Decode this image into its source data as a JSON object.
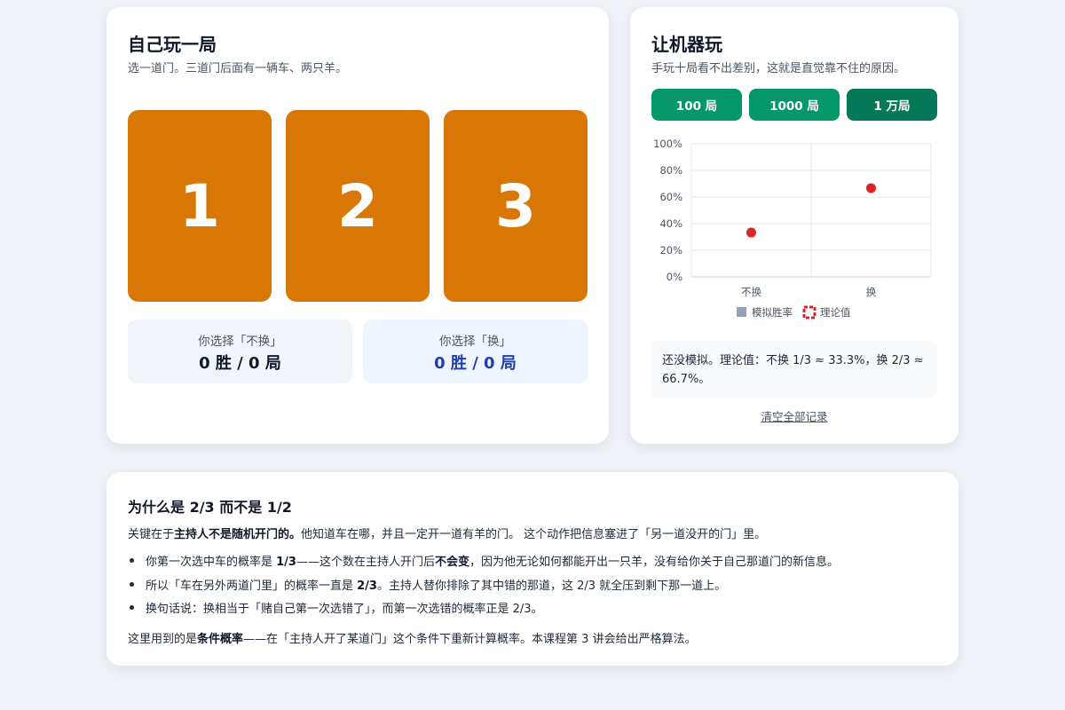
{
  "play": {
    "title": "自己玩一局",
    "subtitle": "选一道门。三道门后面有一辆车、两只羊。",
    "doors": [
      "1",
      "2",
      "3"
    ],
    "door_color": "#d97706",
    "stay": {
      "label": "你选择「不换」",
      "value": "0 胜 / 0 局"
    },
    "switch": {
      "label": "你选择「换」",
      "value": "0 胜 / 0 局"
    }
  },
  "sim": {
    "title": "让机器玩",
    "subtitle": "手玩十局看不出差别，这就是直觉靠不住的原因。",
    "buttons": [
      "100 局",
      "1000 局",
      "1 万局"
    ],
    "button_color": "#059669",
    "note": "还没模拟。理论值：不换 1/3 ≈ 33.3%，换 2/3 ≈ 66.7%。",
    "clear_label": "清空全部记录"
  },
  "chart_data": {
    "type": "bar",
    "categories": [
      "不换",
      "换"
    ],
    "series": [
      {
        "name": "模拟胜率",
        "values": [
          null,
          null
        ],
        "color": "#94a3b8"
      },
      {
        "name": "理论值",
        "values": [
          33.3,
          66.7
        ],
        "color": "#dc2626"
      }
    ],
    "ylim": [
      0,
      100
    ],
    "yticks": [
      "0%",
      "20%",
      "40%",
      "60%",
      "80%",
      "100%"
    ],
    "legend_position": "bottom",
    "grid": true
  },
  "explain": {
    "title": "为什么是 2/3 而不是 1/2",
    "intro": [
      {
        "t": "关键在于"
      },
      {
        "t": "主持人不是随机开门的。",
        "b": true
      },
      {
        "t": "他知道车在哪，并且一定开一道有羊的门。 这个动作把信息塞进了「另一道没开的门」里。"
      }
    ],
    "bullets": [
      [
        {
          "t": "你第一次选中车的概率是 "
        },
        {
          "t": "1/3",
          "b": true
        },
        {
          "t": "——这个数在主持人开门后"
        },
        {
          "t": "不会变",
          "b": true
        },
        {
          "t": "，因为他无论如何都能开出一只羊，没有给你关于自己那道门的新信息。"
        }
      ],
      [
        {
          "t": "所以「车在另外两道门里」的概率一直是 "
        },
        {
          "t": "2/3",
          "b": true
        },
        {
          "t": "。主持人替你排除了其中错的那道，这 2/3 就全压到剩下那一道上。"
        }
      ],
      [
        {
          "t": "换句话说：换相当于「赌自己第一次选错了」，而第一次选错的概率正是 2/3。"
        }
      ]
    ],
    "outro": [
      {
        "t": "这里用到的是"
      },
      {
        "t": "条件概率",
        "b": true
      },
      {
        "t": "——在「主持人开了某道门」这个条件下重新计算概率。本课程第 3 讲会给出严格算法。"
      }
    ]
  }
}
